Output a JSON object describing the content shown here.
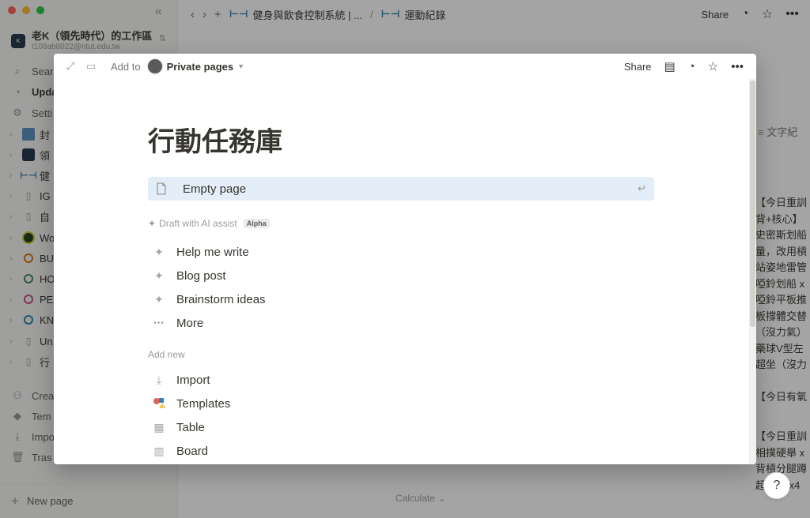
{
  "colors": {
    "accent": "#337ea9",
    "selected_bg": "#e3eef9",
    "overlay": "rgba(15,15,15,0.38)"
  },
  "sidebar": {
    "workspace_name": "老K（領先時代）的工作區",
    "workspace_email": "t108ab8022@ntut.edu.tw",
    "nav": [
      {
        "label": "Sear",
        "icon": "search-icon"
      },
      {
        "label": "Upda",
        "icon": "clock-icon"
      },
      {
        "label": "Setti",
        "icon": "gear-icon"
      }
    ],
    "pages": [
      {
        "label": "封",
        "icon": "cover-page-icon"
      },
      {
        "label": "領",
        "icon": "workspace-logo-icon"
      },
      {
        "label": "健",
        "icon": "dumbbell-icon"
      },
      {
        "label": "IG",
        "icon": "document-icon"
      },
      {
        "label": "自",
        "icon": "document-icon"
      },
      {
        "label": "Wo",
        "icon": "nm-badge-icon"
      },
      {
        "label": "BU",
        "icon": "orange-circle-icon"
      },
      {
        "label": "HO",
        "icon": "green-circle-icon"
      },
      {
        "label": "PE",
        "icon": "pink-circle-icon"
      },
      {
        "label": "KN",
        "icon": "blue-circle-icon"
      },
      {
        "label": "Un",
        "icon": "document-icon"
      },
      {
        "label": "行",
        "icon": "document-icon"
      }
    ],
    "bottom": [
      {
        "label": "Crea",
        "icon": "people-icon"
      },
      {
        "label": "Tem",
        "icon": "templates-icon"
      },
      {
        "label": "Impo",
        "icon": "download-icon"
      },
      {
        "label": "Tras",
        "icon": "trash-icon"
      }
    ],
    "new_page": "New page"
  },
  "topbar": {
    "breadcrumb_1": "健身與飲食控制系統 | ...",
    "separator": "/",
    "breadcrumb_2": "運動紀錄",
    "share": "Share"
  },
  "background": {
    "column_header": "文字紀",
    "cells": [
      "【今日重訓",
      "背+核心】",
      "史密斯划船",
      "量，改用槓",
      "站姿地雷管",
      "啞鈴划船 x",
      "啞鈴平板推",
      "板撐體交替",
      "（沒力氣）",
      "藥球V型左",
      "超坐（沒力",
      "",
      "【今日有氧",
      "",
      "",
      "【今日重訓",
      "相撲硬舉 x",
      "背槓分腿蹲",
      "超級組 x4"
    ],
    "calculate": "Calculate",
    "help": "?"
  },
  "modal": {
    "add_to": "Add to",
    "location": "Private pages",
    "share": "Share",
    "title": "行動任務庫",
    "empty_page": "Empty page",
    "draft_label": "Draft with AI assist",
    "alpha_badge": "Alpha",
    "ai_options": [
      "Help me write",
      "Blog post",
      "Brainstorm ideas"
    ],
    "more": "More",
    "add_new_label": "Add new",
    "add_new_options": [
      {
        "label": "Import",
        "icon": "import-icon"
      },
      {
        "label": "Templates",
        "icon": "templates-icon"
      },
      {
        "label": "Table",
        "icon": "table-icon"
      },
      {
        "label": "Board",
        "icon": "board-icon"
      }
    ]
  }
}
